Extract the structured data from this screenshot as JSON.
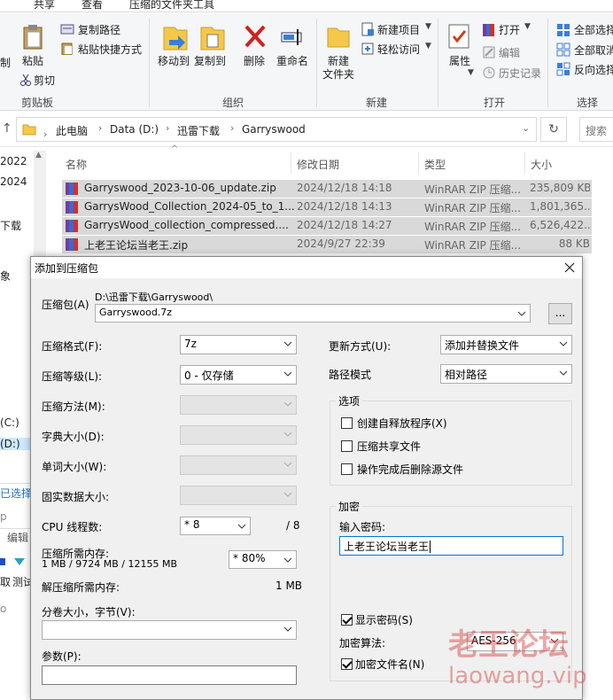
{
  "ribbon": {
    "tabs": [
      "共享",
      "查看",
      "压缩的文件夹工具"
    ],
    "clipboard": {
      "partial": "制",
      "paste": "粘贴",
      "copy_path": "复制路径",
      "paste_shortcut": "粘贴快捷方式",
      "cut": "剪切",
      "group": "剪贴板"
    },
    "organize": {
      "move_to": "移动到",
      "copy_to": "复制到",
      "delete": "删除",
      "rename": "重命名",
      "group": "组织"
    },
    "new": {
      "new_folder_line1": "新建",
      "new_folder_line2": "文件夹",
      "new_item": "新建项目",
      "easy_access": "轻松访问",
      "group": "新建"
    },
    "open": {
      "properties": "属性",
      "open": "打开",
      "edit": "编辑",
      "history": "历史记录",
      "group": "打开"
    },
    "select": {
      "select_all": "全部选择",
      "select_none": "全部取消",
      "invert": "反向选择",
      "group": "选择"
    }
  },
  "address": {
    "crumbs": [
      "此电脑",
      "Data (D:)",
      "迅雷下载",
      "Garryswood"
    ],
    "search_placeholder": "搜索"
  },
  "nav": {
    "items": [
      "2022",
      "2024",
      "下载",
      "象",
      "(C:)",
      "(D:)",
      "已选择",
      "p",
      "编辑",
      "取",
      "测试",
      "o"
    ]
  },
  "filelist": {
    "columns": [
      "名称",
      "修改日期",
      "类型",
      "大小"
    ],
    "rows": [
      {
        "name": "Garryswood_2023-10-06_update.zip",
        "date": "2024/12/18 14:18",
        "type": "WinRAR ZIP 压缩...",
        "size": "235,809 KB"
      },
      {
        "name": "GarrysWood_Collection_2024-05_to_1...",
        "date": "2024/12/18 14:13",
        "type": "WinRAR ZIP 压缩...",
        "size": "1,801,365..."
      },
      {
        "name": "GarrysWood_collection_compressed....",
        "date": "2024/12/18 14:27",
        "type": "WinRAR ZIP 压缩...",
        "size": "6,526,422..."
      },
      {
        "name": "上老王论坛当老王.zip",
        "date": "2024/9/27 22:39",
        "type": "WinRAR ZIP 压缩...",
        "size": "88 KB"
      }
    ]
  },
  "dialog": {
    "title": "添加到压缩包",
    "archive_label": "压缩包(A)",
    "archive_path": "D:\\迅雷下载\\Garryswood\\",
    "archive_name": "Garryswood.7z",
    "browse": "...",
    "format_label": "压缩格式(F):",
    "format_value": "7z",
    "level_label": "压缩等级(L):",
    "level_value": "0 - 仅存储",
    "method_label": "压缩方法(M):",
    "dict_label": "字典大小(D):",
    "word_label": "单词大小(W):",
    "solid_label": "固实数据大小:",
    "cpu_label": "CPU 线程数:",
    "cpu_value": "* 8",
    "cpu_max": "/ 8",
    "mem_label": "压缩所需内存:",
    "mem_detail": "1 MB / 9724 MB / 12155 MB",
    "mem_value": "* 80%",
    "decomp_label": "解压缩所需内存:",
    "decomp_value": "1 MB",
    "split_label": "分卷大小，字节(V):",
    "params_label": "参数(P):",
    "update_label": "更新方式(U):",
    "update_value": "添加并替换文件",
    "pathmode_label": "路径模式",
    "pathmode_value": "相对路径",
    "options_title": "选项",
    "opt_sfx": "创建自释放程序(X)",
    "opt_shared": "压缩共享文件",
    "opt_delete": "操作完成后删除源文件",
    "encrypt_title": "加密",
    "password_label": "输入密码:",
    "password_value": "上老王论坛当老王",
    "show_password": "显示密码(S)",
    "enc_method_label": "加密算法:",
    "enc_method_value": "AES-256",
    "encrypt_names": "加密文件名(N)"
  },
  "watermark": {
    "line1": "老王论坛",
    "line2": "laowang.vip"
  }
}
